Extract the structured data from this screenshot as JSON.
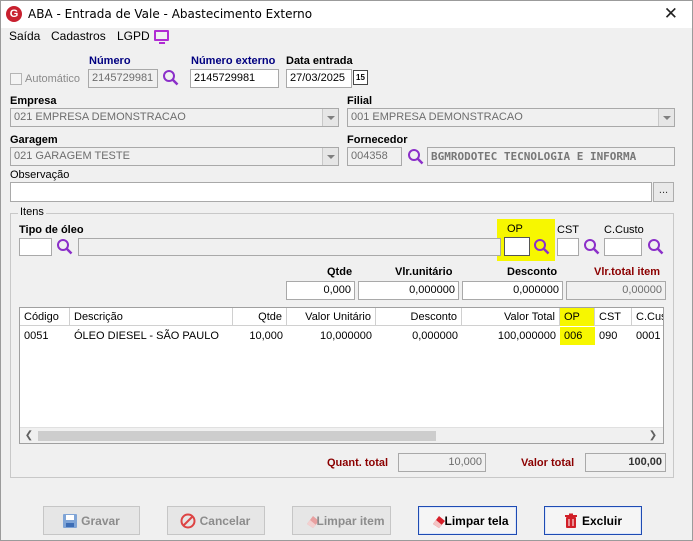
{
  "window": {
    "title": "ABA - Entrada de Vale - Abastecimento Externo",
    "app_icon_letter": "G",
    "close_glyph": "✕"
  },
  "menu": {
    "items": [
      "Saída",
      "Cadastros",
      "LGPD"
    ]
  },
  "header_fields": {
    "automatico_label": "Automático",
    "numero_label": "Número",
    "numero_value": "2145729981",
    "numero_externo_label": "Número externo",
    "numero_externo_value": "2145729981",
    "data_entrada_label": "Data entrada",
    "data_entrada_value": "27/03/2025",
    "calendar_glyph": "15"
  },
  "empresa": {
    "label": "Empresa",
    "value": "021 EMPRESA DEMONSTRACAO"
  },
  "filial": {
    "label": "Filial",
    "value": "001 EMPRESA DEMONSTRACAO"
  },
  "garagem": {
    "label": "Garagem",
    "value": "021 GARAGEM TESTE"
  },
  "fornecedor": {
    "label": "Fornecedor",
    "code": "004358",
    "name": "BGMRODOTEC TECNOLOGIA E INFORMA"
  },
  "observacao": {
    "label": "Observação",
    "value": "",
    "ellipsis": "..."
  },
  "itens": {
    "group_label": "Itens",
    "tipo_oleo_label": "Tipo de óleo",
    "op_label": "OP",
    "cst_label": "CST",
    "ccusto_label": "C.Custo",
    "qtde_label": "Qtde",
    "vlr_unitario_label": "Vlr.unitário",
    "desconto_label": "Desconto",
    "vlr_total_item_label": "Vlr.total item",
    "qtde_value": "0,000",
    "vlr_unitario_value": "0,000000",
    "desconto_value": "0,000000",
    "vlr_total_item_value": "0,00000"
  },
  "grid": {
    "columns": [
      "Código",
      "Descrição",
      "Qtde",
      "Valor Unitário",
      "Desconto",
      "Valor Total",
      "OP",
      "CST",
      "C.Cus"
    ],
    "rows": [
      [
        "0051",
        "ÓLEO DIESEL - SÃO PAULO",
        "10,000",
        "10,000000",
        "0,000000",
        "100,000000",
        "006",
        "090",
        "0001"
      ]
    ]
  },
  "totals": {
    "quant_total_label": "Quant. total",
    "quant_total_value": "10,000",
    "valor_total_label": "Valor total",
    "valor_total_value": "100,00"
  },
  "buttons": {
    "gravar": "Gravar",
    "cancelar": "Cancelar",
    "limpar_item": "Limpar item",
    "limpar_tela": "Limpar tela",
    "excluir": "Excluir"
  },
  "colors": {
    "highlight": "#f7f700",
    "navy_label": "#000080",
    "total_label": "#8b0000",
    "search_icon": "#8b2fc9",
    "lgpd_icon": "#b02bd3"
  }
}
